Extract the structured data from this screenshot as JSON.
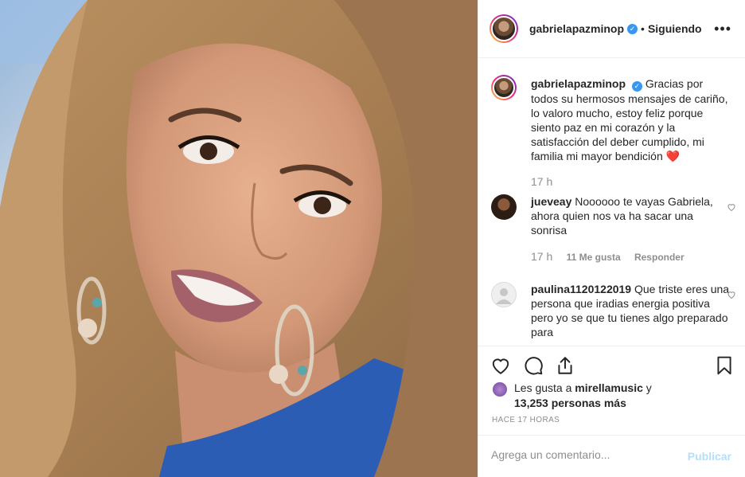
{
  "post": {
    "username": "gabrielapazminop",
    "verified_icon": "verified-badge-icon",
    "follow_status": "Siguiendo",
    "separator": "•",
    "more_icon": "more-options-icon",
    "caption_text": "Gracias por todos su hermosos mensajes de cariño, lo valoro mucho, estoy feliz porque siento paz en mi corazón y la satisfacción del deber cumplido, mi familia mi mayor bendición",
    "caption_emoji": "❤️",
    "caption_time": "17 h"
  },
  "comments": [
    {
      "username": "jueveay",
      "text": "Noooooo te vayas Gabriela, ahora quien nos va ha sacar una sonrisa",
      "time": "17 h",
      "likes": "11 Me gusta",
      "reply": "Responder"
    },
    {
      "username": "paulina1120122019",
      "text": "Que triste eres una persona que iradias energia positiva pero yo se que tu tienes algo preparado para"
    }
  ],
  "actions": {
    "like_icon": "heart-icon",
    "comment_icon": "comment-icon",
    "share_icon": "share-icon",
    "save_icon": "bookmark-icon"
  },
  "likes": {
    "prefix": "Les gusta a",
    "user": "mirellamusic",
    "conjunction": "y",
    "count": "13,253 personas más"
  },
  "timestamp": "Hace 17 horas",
  "add_comment": {
    "placeholder": "Agrega un comentario...",
    "publish": "Publicar"
  },
  "colors": {
    "accent": "#3897f0",
    "publish_disabled": "#b2dffc",
    "muted": "#8e8e8e",
    "heart": "#ed4956"
  }
}
